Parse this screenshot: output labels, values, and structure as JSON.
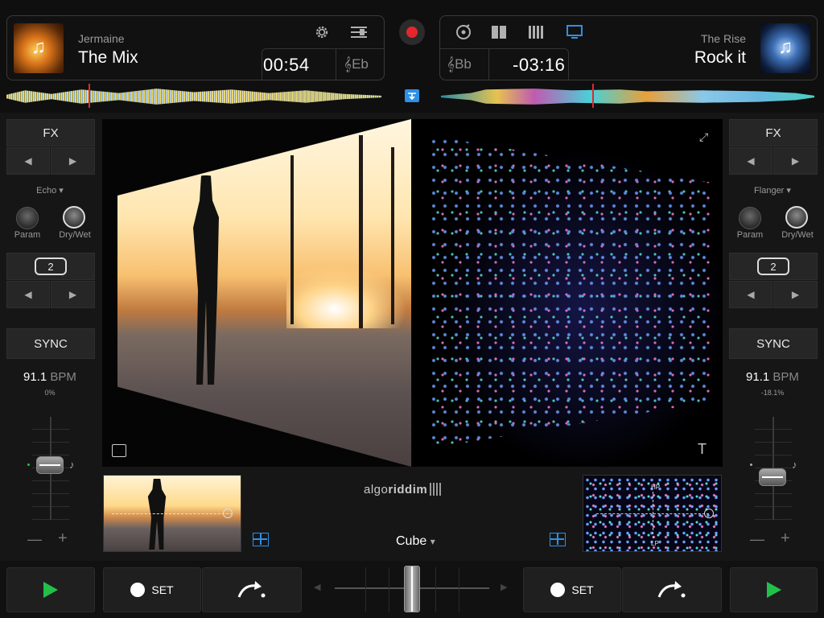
{
  "deck_left": {
    "artist": "Jermaine",
    "title": "The Mix",
    "time": "00:54",
    "key": "Eb"
  },
  "deck_right": {
    "artist": "The Rise",
    "title": "Rock it",
    "time": "-03:16",
    "key": "Bb"
  },
  "toolbar": {
    "icons": [
      "gear-icon",
      "equalizer-icon",
      "record-icon",
      "vinyl-icon",
      "split-view-icon",
      "multi-view-icon",
      "monitor-icon"
    ],
    "accent": "#2e8fe6",
    "record_color": "#e5262d"
  },
  "left_panel": {
    "fx_label": "FX",
    "effect_name": "Echo",
    "param_label": "Param",
    "drywet_label": "Dry/Wet",
    "loop_value": "2",
    "sync_label": "SYNC",
    "bpm_value": "91.1",
    "bpm_unit": "BPM",
    "pitch_pct": "0%"
  },
  "right_panel": {
    "fx_label": "FX",
    "effect_name": "Flanger",
    "param_label": "Param",
    "drywet_label": "Dry/Wet",
    "loop_value": "2",
    "sync_label": "SYNC",
    "bpm_value": "91.1",
    "bpm_unit": "BPM",
    "pitch_pct": "-18.1%"
  },
  "center": {
    "brand_prefix": "algo",
    "brand_suffix": "riddim",
    "transition": "Cube",
    "hp_label": "HP",
    "lp_label": "LP"
  },
  "bottom": {
    "set_label_left": "SET",
    "set_label_right": "SET",
    "play_color": "#22c04a"
  }
}
